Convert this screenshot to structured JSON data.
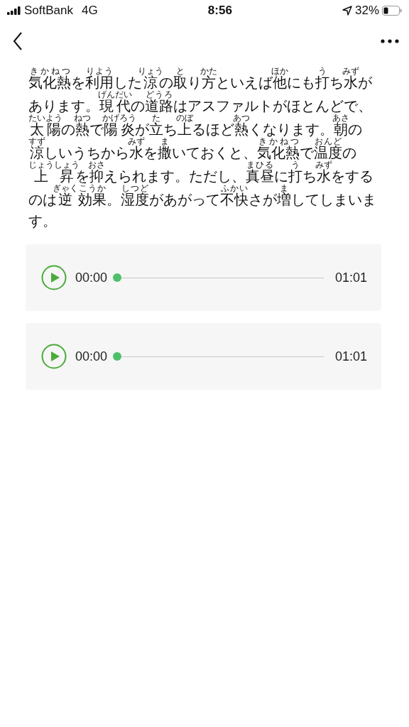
{
  "status_bar": {
    "carrier": "SoftBank",
    "network": "4G",
    "time": "8:56",
    "battery": "32%"
  },
  "article": {
    "lines": [
      [
        {
          "t": "気化熱",
          "r": "きかねつ"
        },
        {
          "t": "を"
        },
        {
          "t": "利用",
          "r": "りよう"
        },
        {
          "t": "した"
        },
        {
          "t": "涼",
          "r": "りょう"
        },
        {
          "t": "の"
        },
        {
          "t": "取",
          "r": "と"
        },
        {
          "t": "り"
        },
        {
          "t": "方",
          "r": "かた"
        },
        {
          "t": "といえば"
        },
        {
          "t": "他",
          "r": "ほか"
        },
        {
          "t": "にも"
        },
        {
          "t": "打",
          "r": "う"
        },
        {
          "t": "ち"
        },
        {
          "t": "水",
          "r": "みず"
        },
        {
          "t": "が"
        }
      ],
      [
        {
          "t": "あります。"
        },
        {
          "t": "現代",
          "r": "げんだい"
        },
        {
          "t": "の"
        },
        {
          "t": "道路",
          "r": "どうろ"
        },
        {
          "t": "はアスファルトがほとんどで、"
        }
      ],
      [
        {
          "t": "太陽",
          "r": "たいよう"
        },
        {
          "t": "の"
        },
        {
          "t": "熱",
          "r": "ねつ"
        },
        {
          "t": "で"
        },
        {
          "t": "陽炎",
          "r": "かげろう"
        },
        {
          "t": "が"
        },
        {
          "t": "立",
          "r": "た"
        },
        {
          "t": "ち"
        },
        {
          "t": "上",
          "r": "のぼ"
        },
        {
          "t": "るほど"
        },
        {
          "t": "熱",
          "r": "あつ"
        },
        {
          "t": "くなります。"
        },
        {
          "t": "朝",
          "r": "あさ"
        },
        {
          "t": "の"
        }
      ],
      [
        {
          "t": "涼",
          "r": "すず"
        },
        {
          "t": "しいうちから"
        },
        {
          "t": "水",
          "r": "みず"
        },
        {
          "t": "を"
        },
        {
          "t": "撒",
          "r": "ま"
        },
        {
          "t": "いておくと、"
        },
        {
          "t": "気化熱",
          "r": "きかねつ"
        },
        {
          "t": "で"
        },
        {
          "t": "温度",
          "r": "おんど"
        },
        {
          "t": "の"
        }
      ],
      [
        {
          "t": "上",
          "r": "じょう"
        },
        {
          "t": "昇",
          "r": "しょう"
        },
        {
          "t": "を"
        },
        {
          "t": "抑",
          "r": "おさ"
        },
        {
          "t": "えられます。ただし、"
        },
        {
          "t": "真昼",
          "r": "まひる"
        },
        {
          "t": "に"
        },
        {
          "t": "打",
          "r": "う"
        },
        {
          "t": "ち"
        },
        {
          "t": "水",
          "r": "みず"
        },
        {
          "t": "をする"
        }
      ],
      [
        {
          "t": "のは"
        },
        {
          "t": "逆",
          "r": "ぎゃく"
        },
        {
          "t": "効果",
          "r": "こうか"
        },
        {
          "t": "。"
        },
        {
          "t": "湿度",
          "r": "しつど"
        },
        {
          "t": "があがって"
        },
        {
          "t": "不快",
          "r": "ふかい"
        },
        {
          "t": "さが"
        },
        {
          "t": "増",
          "r": "ま"
        },
        {
          "t": "してしまいま"
        }
      ],
      [
        {
          "t": "す。"
        }
      ]
    ]
  },
  "players": [
    {
      "current": "00:00",
      "level": 0,
      "total": "01:01"
    },
    {
      "current": "00:00",
      "level": 0,
      "total": "01:01"
    }
  ]
}
